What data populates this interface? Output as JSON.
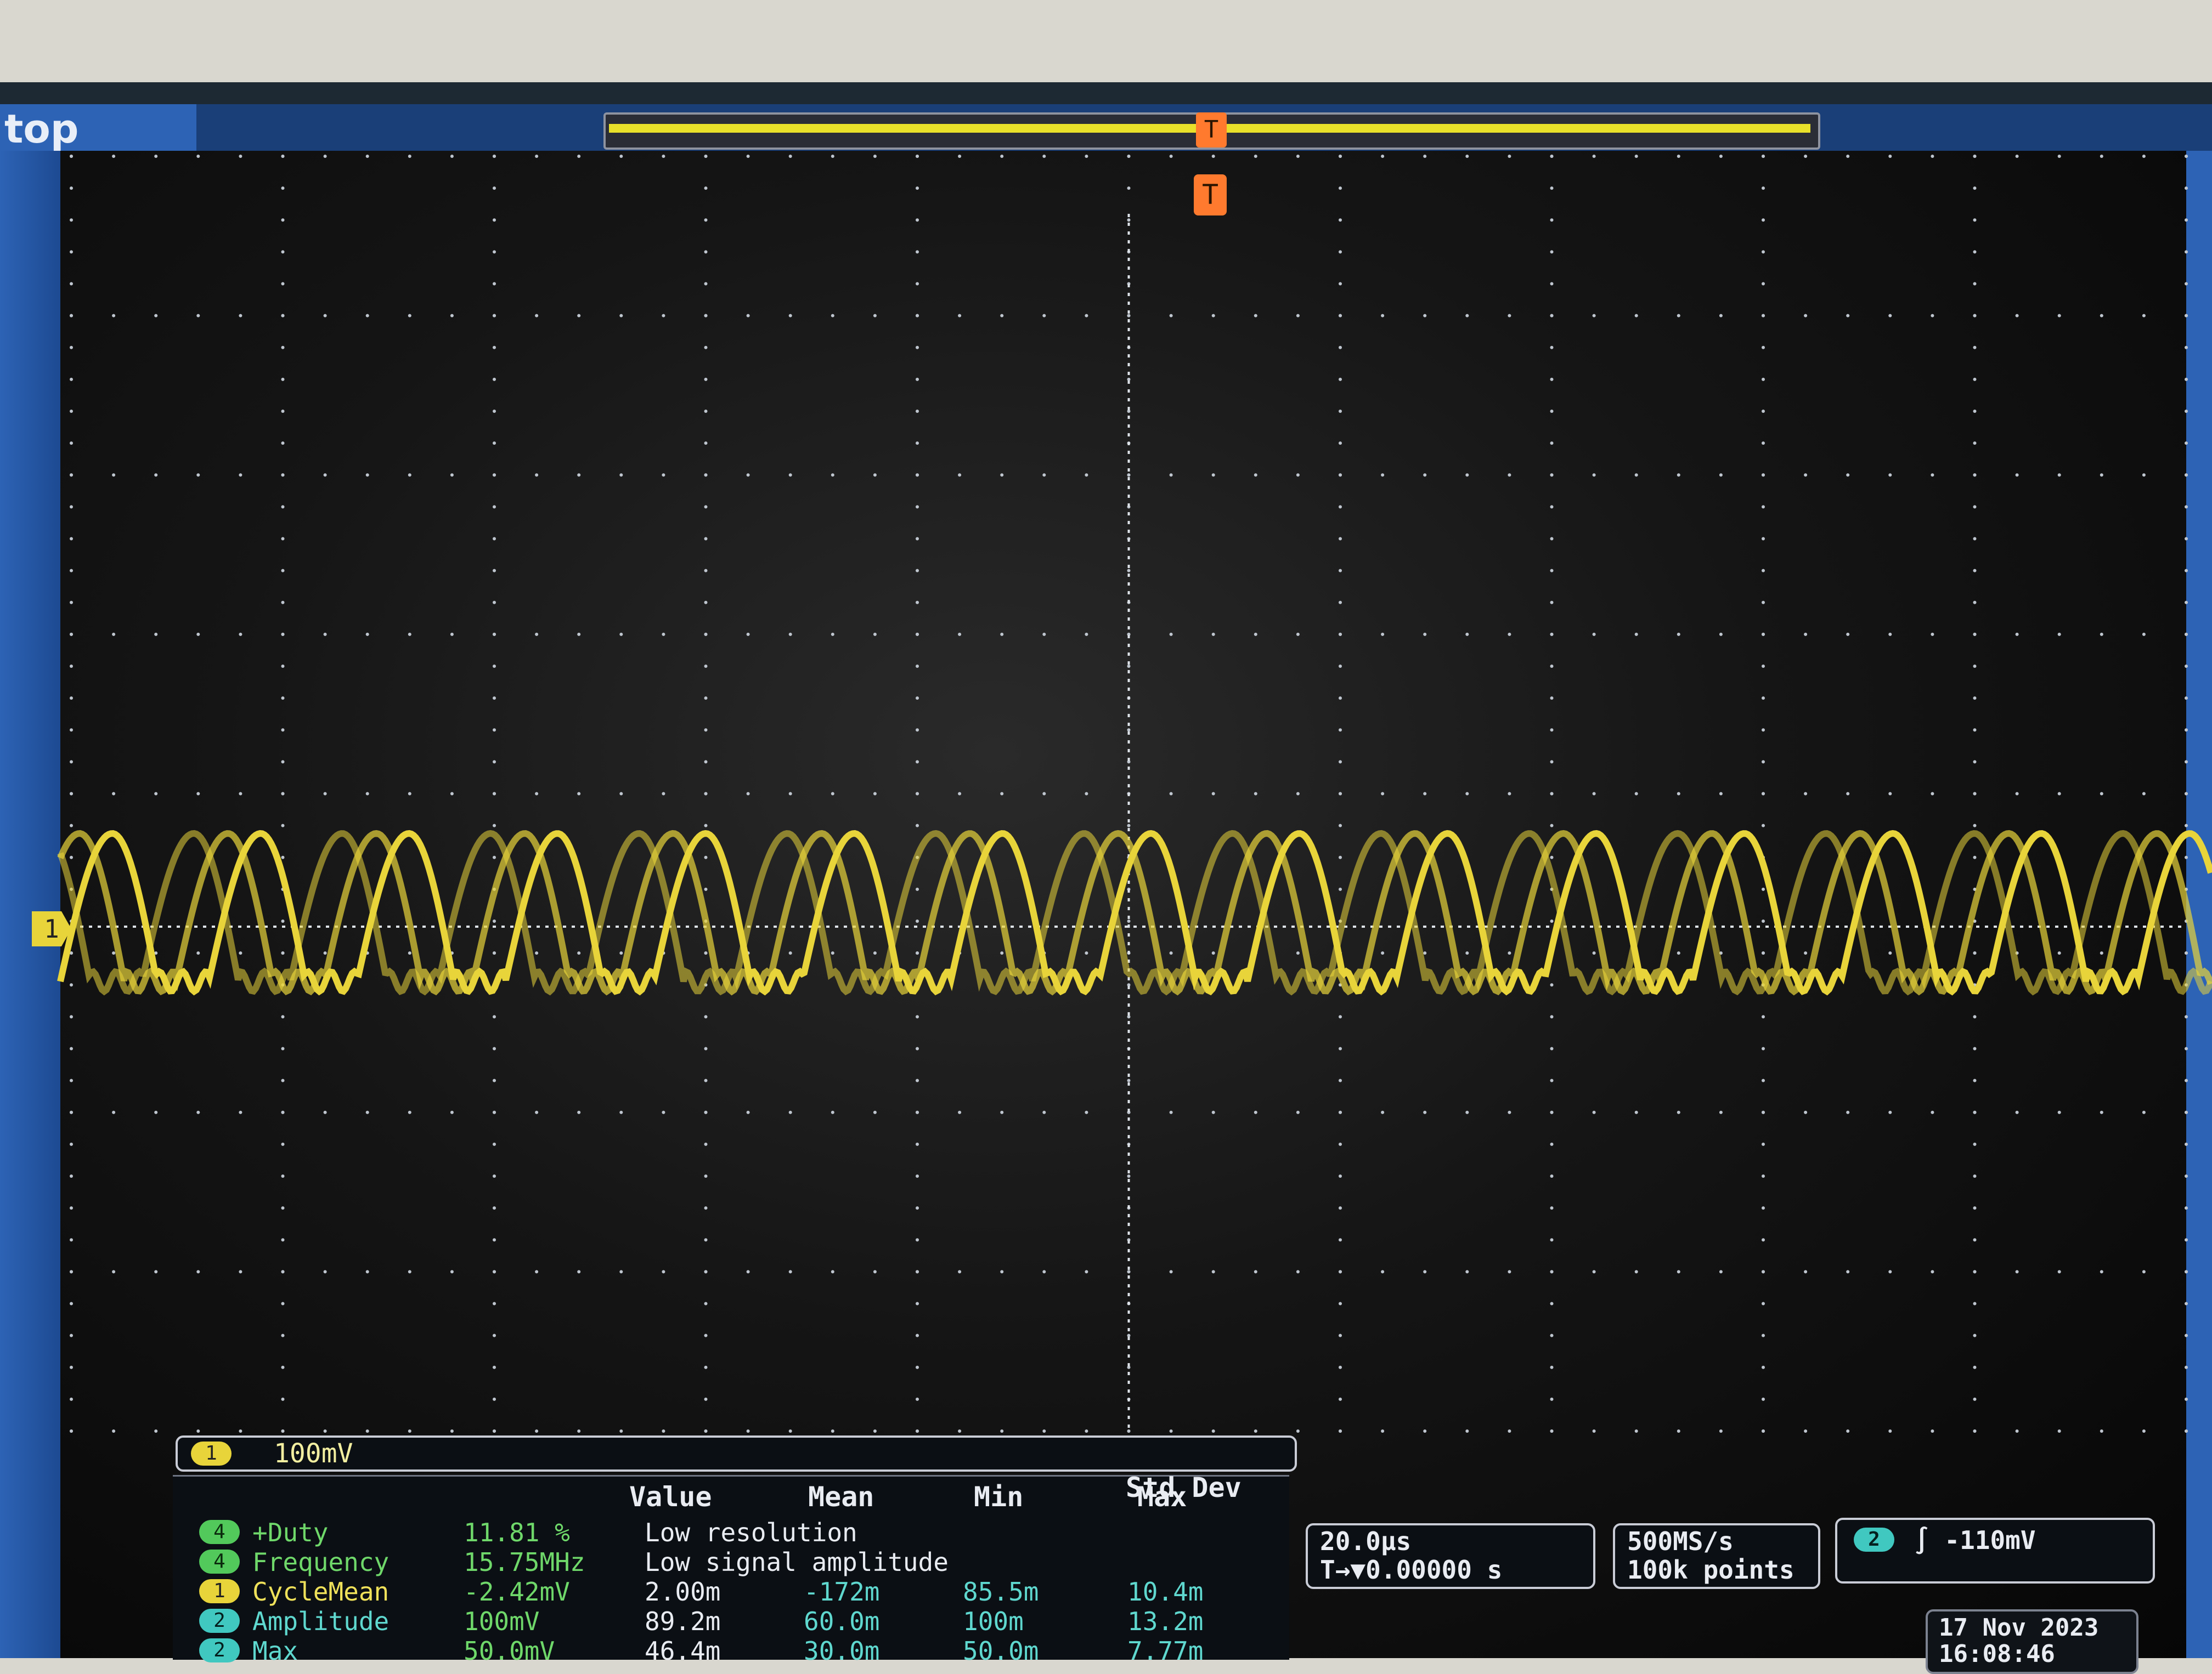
{
  "status": {
    "state": "top"
  },
  "markers": {
    "trigger_position": "T",
    "trigger_level": "T",
    "channel1": "1"
  },
  "colors": {
    "ch1": "#e8d43a",
    "ch2": "#40c8c0",
    "ch4": "#52c95b",
    "trigger": "#ff7a2e",
    "frame": "#2d63b5"
  },
  "waveform": {
    "channel": 1,
    "cycles_on_screen": 14.5,
    "overlaid_traces": 3
  },
  "channel_readout": {
    "badge": "1",
    "scale": "100mV"
  },
  "measurements": {
    "headers": {
      "value": "Value",
      "mean": "Mean",
      "min": "Min",
      "max": "Max",
      "stddev": "Std Dev"
    },
    "rows": [
      {
        "ch": "4",
        "name": "+Duty",
        "value": "11.81 %",
        "mean": "Low resolution",
        "min": "",
        "max": "",
        "stddev": ""
      },
      {
        "ch": "4",
        "name": "Frequency",
        "value": "15.75MHz",
        "mean": "Low signal amplitude",
        "min": "",
        "max": "",
        "stddev": ""
      },
      {
        "ch": "1",
        "name": "CycleMean",
        "value": "-2.42mV",
        "mean": "2.00m",
        "min": "-172m",
        "max": "85.5m",
        "stddev": "10.4m"
      },
      {
        "ch": "2",
        "name": "Amplitude",
        "value": "100mV",
        "mean": "89.2m",
        "min": "60.0m",
        "max": "100m",
        "stddev": "13.2m"
      },
      {
        "ch": "2",
        "name": "Max",
        "value": "50.0mV",
        "mean": "46.4m",
        "min": "30.0m",
        "max": "50.0m",
        "stddev": "7.77m"
      }
    ]
  },
  "timebase": {
    "scale": "20.0µs",
    "position": "T→▼0.00000 s"
  },
  "acquisition": {
    "sample_rate": "500MS/s",
    "record_length": "100k points"
  },
  "trigger": {
    "badge": "2",
    "level": "∫ -110mV"
  },
  "datetime": {
    "date": "17 Nov 2023",
    "time": "16:08:46"
  }
}
